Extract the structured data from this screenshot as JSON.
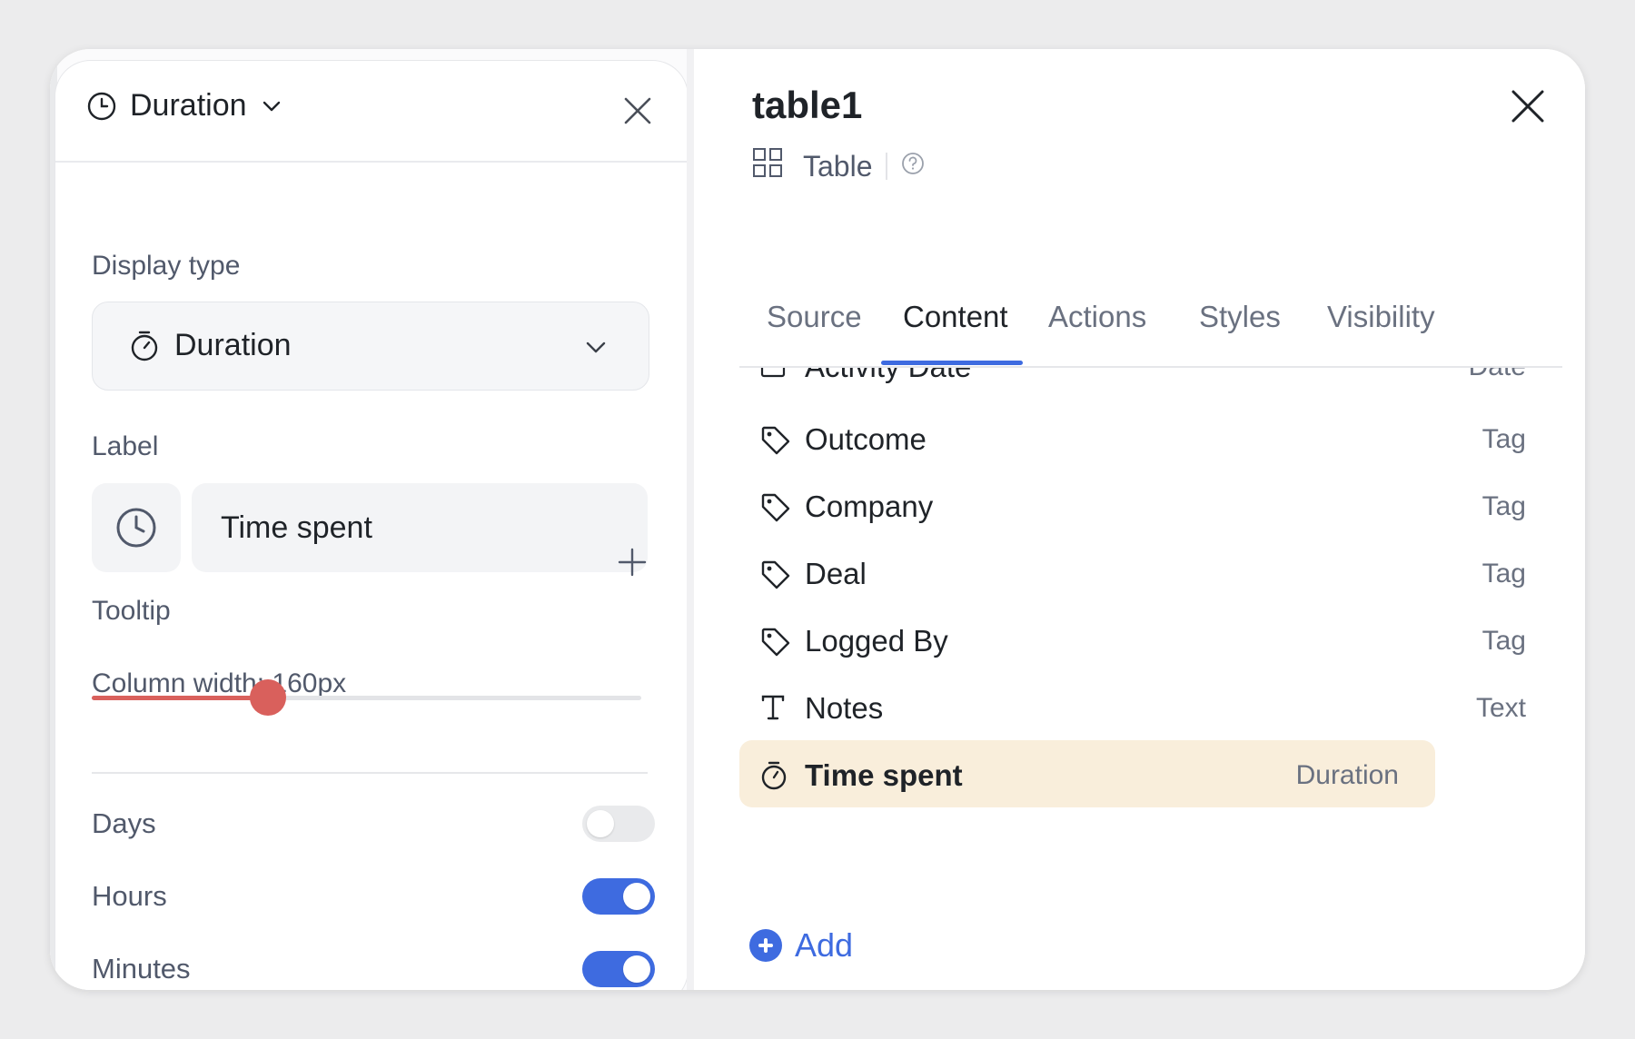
{
  "left_panel": {
    "header_title": "Duration",
    "display_type_label": "Display type",
    "display_type_value": "Duration",
    "label_section": "Label",
    "label_value": "Time spent",
    "tooltip_label": "Tooltip",
    "column_width_label": "Column width: 160px",
    "column_width_fraction": 0.32,
    "toggles": [
      {
        "label": "Days",
        "on": false
      },
      {
        "label": "Hours",
        "on": true
      },
      {
        "label": "Minutes",
        "on": true
      }
    ]
  },
  "right_panel": {
    "title": "table1",
    "subtitle": "Table",
    "tabs": [
      "Source",
      "Content",
      "Actions",
      "Styles",
      "Visibility"
    ],
    "active_tab": "Content",
    "columns": [
      {
        "label": "Activity Date",
        "type": "Date",
        "icon": "calendar-icon"
      },
      {
        "label": "Outcome",
        "type": "Tag",
        "icon": "tag-icon"
      },
      {
        "label": "Company",
        "type": "Tag",
        "icon": "tag-icon"
      },
      {
        "label": "Deal",
        "type": "Tag",
        "icon": "tag-icon"
      },
      {
        "label": "Logged By",
        "type": "Tag",
        "icon": "tag-icon"
      },
      {
        "label": "Notes",
        "type": "Text",
        "icon": "text-icon"
      },
      {
        "label": "Time spent",
        "type": "Duration",
        "icon": "stopwatch-icon",
        "selected": true
      }
    ],
    "add_label": "Add"
  },
  "colors": {
    "accent": "#3e6be0",
    "slider": "#d9605c",
    "selected_row": "#f9eedb"
  }
}
